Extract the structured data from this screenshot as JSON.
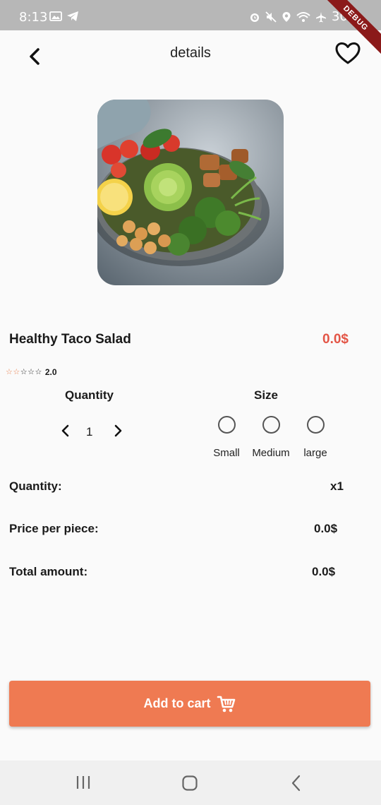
{
  "status_bar": {
    "time": "8:13",
    "battery": "30%",
    "debug_label": "DEBUG"
  },
  "header": {
    "title": "details",
    "back_icon": "chevron-left-icon",
    "favorite_icon": "heart-outline-icon"
  },
  "product": {
    "name": "Healthy Taco Salad",
    "price": "0.0$",
    "rating": 2.0,
    "rating_text": "2.0",
    "rating_max": 5,
    "image": "salad-bowl-image"
  },
  "quantity_selector": {
    "heading": "Quantity",
    "value": "1"
  },
  "size_selector": {
    "heading": "Size",
    "options": [
      "Small",
      "Medium",
      "large"
    ]
  },
  "summary": {
    "quantity_label": "Quantity:",
    "quantity_value": "x1",
    "price_label": "Price per piece:",
    "price_value": "0.0$",
    "total_label": "Total amount:",
    "total_value": "0.0$"
  },
  "cart_button": {
    "label": "Add to cart",
    "icon": "cart-icon"
  },
  "colors": {
    "accent": "#ef7a52",
    "price": "#e35546",
    "star": "#e8804f"
  }
}
